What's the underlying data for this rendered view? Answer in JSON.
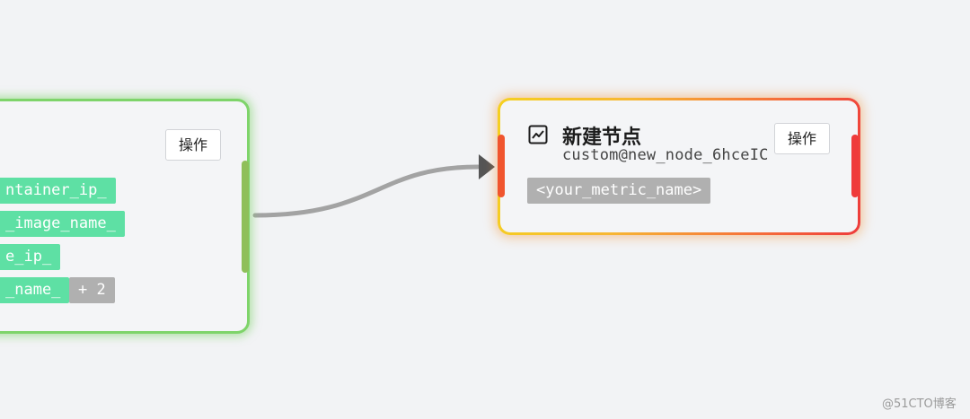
{
  "left_node": {
    "action_label": "操作",
    "tags": [
      "ntainer_ip_",
      "_image_name_",
      "e_ip_",
      "_name_"
    ],
    "more_tag": "+ 2"
  },
  "right_node": {
    "title": "新建节点",
    "subtitle": "custom@new_node_6hceIC",
    "action_label": "操作",
    "metric_tag": "<your_metric_name>",
    "icon": "trend-chart-icon"
  },
  "edge": {
    "color": "#a3a3a3",
    "arrow_color": "#555555"
  },
  "watermark": "@51CTO博客",
  "colors": {
    "background": "#f2f3f5",
    "left_border": "#7ed46a",
    "tag_green": "#5ee0a4",
    "tag_gray": "#b0b0b0",
    "right_border_gradient": [
      "#f5d020",
      "#f7b733",
      "#f56b3a",
      "#ee3b3b"
    ]
  }
}
